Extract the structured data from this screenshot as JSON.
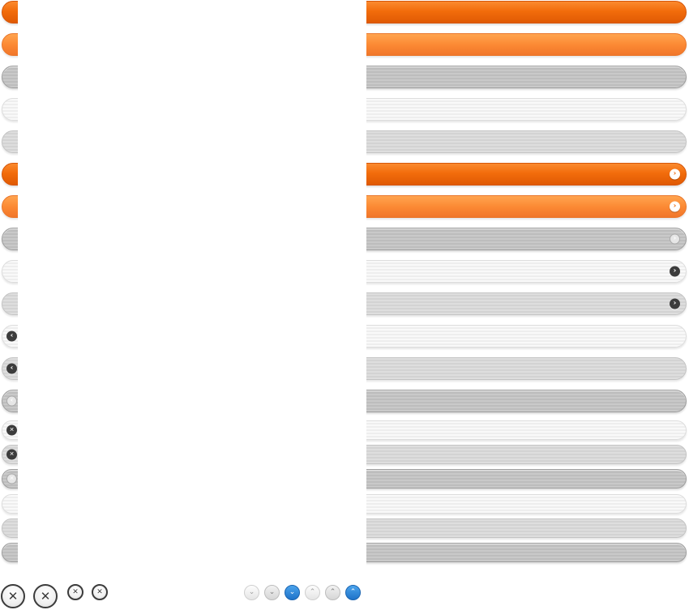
{
  "theme": {
    "orange_dark": "#f26c0b",
    "orange_light": "#fc8a34",
    "gray_dark": "#c2c2c2",
    "gray_white": "#f3f3f3",
    "gray_light": "#d9d9d9",
    "accent_blue": "#2a84dc"
  },
  "bars": [
    {
      "style": "orange-dark",
      "icon": null
    },
    {
      "style": "orange-light",
      "icon": null
    },
    {
      "style": "gray-dark",
      "icon": null
    },
    {
      "style": "gray-white",
      "icon": null
    },
    {
      "style": "gray-light",
      "icon": null
    },
    {
      "style": "orange-dark",
      "icon": "chevron-right-icon"
    },
    {
      "style": "orange-light",
      "icon": "chevron-right-icon"
    },
    {
      "style": "gray-dark",
      "icon": "chevron-right-icon"
    },
    {
      "style": "gray-white",
      "icon": "chevron-right-icon"
    },
    {
      "style": "gray-light",
      "icon": "chevron-right-icon"
    },
    {
      "style": "gray-white",
      "icon": "chevron-left-icon"
    },
    {
      "style": "gray-light",
      "icon": "chevron-left-icon"
    },
    {
      "style": "gray-dark",
      "icon": "chevron-left-icon"
    },
    {
      "style": "gray-white",
      "icon": "close-icon"
    },
    {
      "style": "gray-light",
      "icon": "close-icon"
    },
    {
      "style": "gray-dark",
      "icon": "close-icon"
    },
    {
      "style": "gray-white",
      "icon": null
    },
    {
      "style": "gray-light",
      "icon": null
    },
    {
      "style": "gray-dark",
      "icon": null
    }
  ],
  "glyphs": {
    "chevron_right": "›",
    "chevron_left": "‹",
    "close": "✕",
    "chevron_down": "⌄",
    "chevron_up": "⌃"
  },
  "close_buttons": [
    {
      "size": "large",
      "icon": "close-icon"
    },
    {
      "size": "large",
      "icon": "close-icon"
    },
    {
      "size": "small",
      "icon": "close-icon"
    },
    {
      "size": "small",
      "icon": "close-icon"
    }
  ],
  "chevron_buttons": [
    {
      "direction": "down",
      "style": "light",
      "icon": "chevron-down-icon"
    },
    {
      "direction": "down",
      "style": "mid",
      "icon": "chevron-down-icon"
    },
    {
      "direction": "down",
      "style": "blue",
      "icon": "chevron-down-icon"
    },
    {
      "direction": "up",
      "style": "light",
      "icon": "chevron-up-icon"
    },
    {
      "direction": "up",
      "style": "mid",
      "icon": "chevron-up-icon"
    },
    {
      "direction": "up",
      "style": "blue",
      "icon": "chevron-up-icon"
    }
  ]
}
